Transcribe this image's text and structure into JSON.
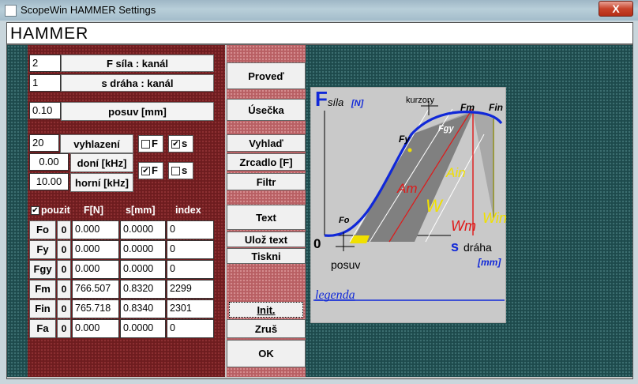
{
  "window": {
    "title": "ScopeWin HAMMER Settings",
    "close_label": "X"
  },
  "header": {
    "title": "HAMMER"
  },
  "channels": [
    {
      "value": "2",
      "label": "F   síla : kanál"
    },
    {
      "value": "1",
      "label": "s   dráha : kanál"
    }
  ],
  "posuv": {
    "value": "0.10",
    "label": "posuv [mm]"
  },
  "filter": {
    "vyhlazeni_value": "20",
    "vyhlazeni_label": "vyhlazení",
    "doni_value": "0.00",
    "doni_label": "doní [kHz]",
    "horni_value": "10.00",
    "horni_label": "horní [kHz]",
    "check_F1_label": "F",
    "check_F1_checked": false,
    "check_s1_label": "s",
    "check_s1_checked": true,
    "check_F2_label": "F",
    "check_F2_checked": true,
    "check_s2_label": "s",
    "check_s2_checked": false
  },
  "table": {
    "pouzit_label": "pouzit",
    "pouzit_checked": true,
    "headers": [
      "F[N]",
      "s[mm]",
      "index"
    ],
    "rows": [
      {
        "label": "Fo",
        "flag": "0",
        "f": "0.000",
        "s": "0.0000",
        "index": "0"
      },
      {
        "label": "Fy",
        "flag": "0",
        "f": "0.000",
        "s": "0.0000",
        "index": "0"
      },
      {
        "label": "Fgy",
        "flag": "0",
        "f": "0.000",
        "s": "0.0000",
        "index": "0"
      },
      {
        "label": "Fm",
        "flag": "0",
        "f": "766.507",
        "s": "0.8320",
        "index": "2299"
      },
      {
        "label": "Fin",
        "flag": "0",
        "f": "765.718",
        "s": "0.8340",
        "index": "2301"
      },
      {
        "label": "Fa",
        "flag": "0",
        "f": "0.000",
        "s": "0.0000",
        "index": "0"
      }
    ]
  },
  "buttons": {
    "proved": "Proveď",
    "usecka": "Úsečka",
    "vyhlad": "Vyhlaď",
    "zrcadlo": "Zrcadlo [F]",
    "filtr": "Filtr",
    "text": "Text",
    "uloz_text": "Ulož text",
    "tiskni": "Tiskni",
    "init": "Init.",
    "zrus": "Zruš",
    "ok": "OK"
  },
  "diagram": {
    "f_letter": "F",
    "sila": "síla",
    "sila_unit": "[N]",
    "kurzory": "kurzory",
    "fm": "Fm",
    "fin": "Fin",
    "fy": "Fy",
    "fgy": "Fgy",
    "fo": "Fo",
    "ain": "Ain",
    "am": "Am",
    "w": "W",
    "wm": "Wm",
    "win": "Win",
    "zero": "0",
    "posuv": "posuv",
    "s_letter": "s",
    "draha": "dráha",
    "draha_unit": "[mm]",
    "legenda": "legenda",
    "colors": {
      "blue": "#1028d8",
      "red": "#e01818",
      "olive": "#8c8c10",
      "yellow": "#f0e000",
      "gray": "#808080",
      "bg": "#c9c9c9"
    }
  }
}
